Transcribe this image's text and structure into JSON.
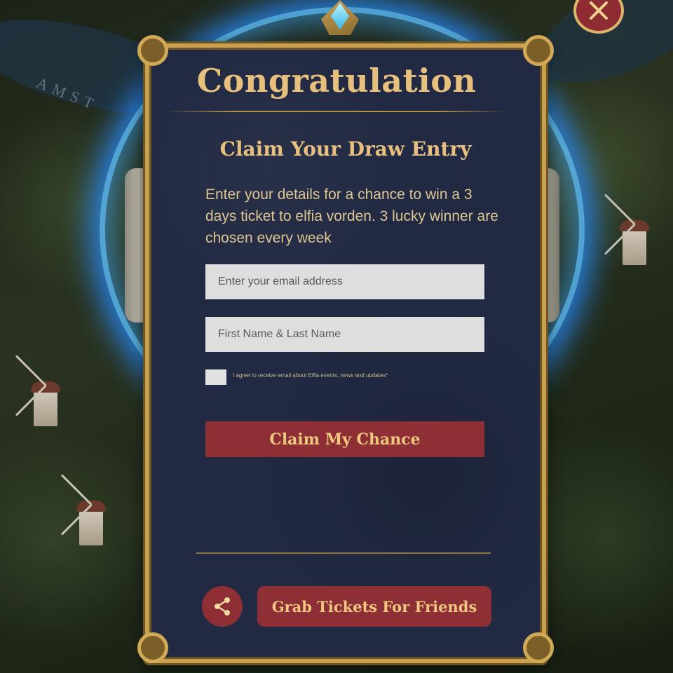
{
  "map": {
    "label": "AMST"
  },
  "dialog": {
    "title": "Congratulation",
    "subtitle": "Claim Your Draw Entry",
    "description": "Enter your details for a chance to win a 3 days ticket to elfia vorden. 3 lucky winner are chosen every week",
    "email_placeholder": "Enter your email address",
    "name_placeholder": "First Name & Last Name",
    "consent_text": "I agree to receive email about Elfia events, news and updates*",
    "claim_button": "Claim My Chance",
    "grab_button": "Grab Tickets For Friends"
  },
  "icons": {
    "close": "close-icon",
    "share": "share-icon",
    "gem": "gem-icon"
  },
  "colors": {
    "panel_bg": "#222a43",
    "gold": "#e8c07d",
    "button_red": "#8e2f35",
    "portal_blue": "#2c8cff"
  }
}
